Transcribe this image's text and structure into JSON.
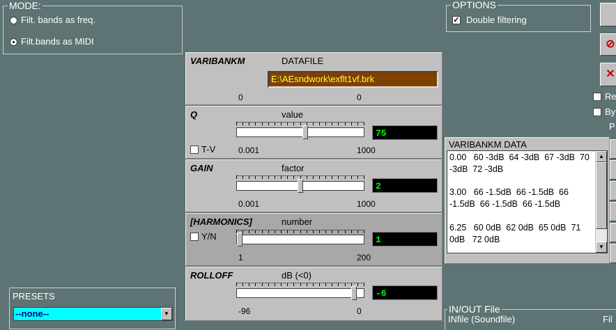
{
  "mode": {
    "title": "MODE:",
    "options": [
      {
        "label": "Filt. bands as freq.",
        "checked": false
      },
      {
        "label": "Filt.bands as MIDI",
        "checked": true
      }
    ]
  },
  "options": {
    "title": "OPTIONS",
    "double_filtering": {
      "label": "Double filtering",
      "checked": true
    }
  },
  "right_edge": {
    "chk1_label": "Re",
    "chk2_label": "By",
    "p_label": "P",
    "inout_fi_label": "Fil"
  },
  "varibank": {
    "title": "VARIBANKM",
    "sub": "DATAFILE",
    "value": "E:\\AEsndwork\\exflt1vf.brk",
    "min": "0",
    "max": "0"
  },
  "q": {
    "title": "Q",
    "sub": "value",
    "value": "75",
    "min": "0.001",
    "max": "1000",
    "tv_label": "T-V",
    "slider_fraction": 0.54
  },
  "gain": {
    "title": "GAIN",
    "sub": "factor",
    "value": "2",
    "min": "0.001",
    "max": "1000",
    "slider_fraction": 0.5
  },
  "harmonics": {
    "title": "[HARMONICS]",
    "sub": "number",
    "value": "1",
    "min": "1",
    "max": "200",
    "yn_label": "Y/N",
    "slider_fraction": 0.0
  },
  "rolloff": {
    "title": "ROLLOFF",
    "sub": "dB (<0)",
    "value": "-6",
    "min": "-96",
    "max": "0",
    "slider_fraction": 0.94
  },
  "data_panel": {
    "title": "VARIBANKM  DATA",
    "lines": [
      "0.00   60 -3dB  64 -3dB  67 -3dB  70",
      "-3dB  72 -3dB",
      "",
      "3.00   66 -1.5dB  66 -1.5dB  66",
      "-1.5dB  66 -1.5dB  66 -1.5dB",
      "",
      "6.25   60 0dB  62 0dB  65 0dB  71",
      "0dB   72 0dB"
    ]
  },
  "presets": {
    "title": "PRESETS",
    "selected": "--none--"
  },
  "inout": {
    "title": "IN/OUT File",
    "infile_label": "INfile (Soundfile)"
  }
}
